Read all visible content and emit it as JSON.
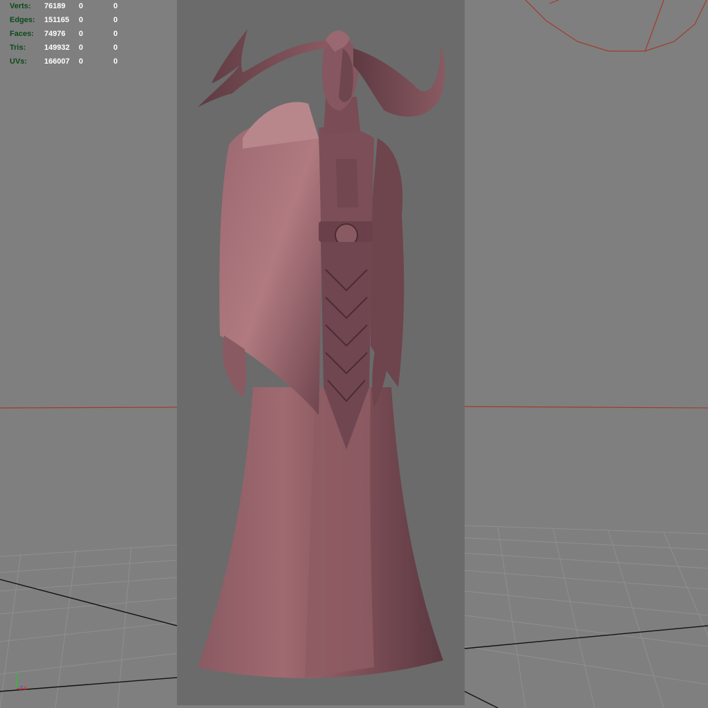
{
  "hud": {
    "rows": [
      {
        "label": "Verts:",
        "v1": "76189",
        "v2": "0",
        "v3": "0"
      },
      {
        "label": "Edges:",
        "v1": "151165",
        "v2": "0",
        "v3": "0"
      },
      {
        "label": "Faces:",
        "v1": "74976",
        "v2": "0",
        "v3": "0"
      },
      {
        "label": "Tris:",
        "v1": "149932",
        "v2": "0",
        "v3": "0"
      },
      {
        "label": "UVs:",
        "v1": "166007",
        "v2": "0",
        "v3": "0"
      }
    ]
  },
  "axis_gizmo": {
    "y": "Y",
    "z": "Z",
    "x": "X"
  },
  "colors": {
    "viewport_bg": "#7f7f7f",
    "render_region_bg": "#6b6b6b",
    "grid_line": "#8f8f8f",
    "axis_red": "#a23a2c",
    "axis_black": "#111111",
    "hud_label": "#0b4a1a",
    "hud_value": "#ffffff",
    "model_base": "#7d5058",
    "model_light": "#b07a80",
    "model_dark": "#4a2c33"
  },
  "icons": {
    "axis": "axis-gizmo-icon"
  }
}
